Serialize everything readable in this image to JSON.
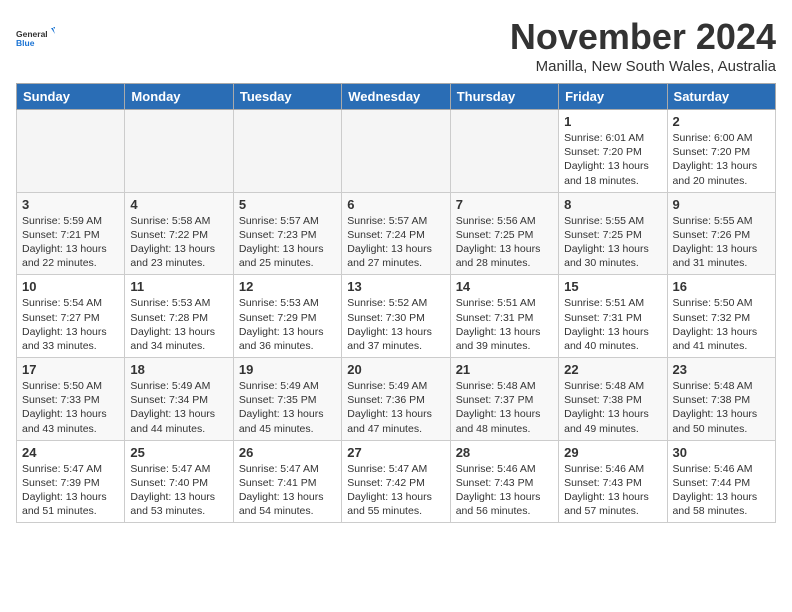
{
  "logo": {
    "line1": "General",
    "line2": "Blue"
  },
  "title": "November 2024",
  "location": "Manilla, New South Wales, Australia",
  "days_of_week": [
    "Sunday",
    "Monday",
    "Tuesday",
    "Wednesday",
    "Thursday",
    "Friday",
    "Saturday"
  ],
  "weeks": [
    [
      {
        "day": "",
        "info": "",
        "empty": true
      },
      {
        "day": "",
        "info": "",
        "empty": true
      },
      {
        "day": "",
        "info": "",
        "empty": true
      },
      {
        "day": "",
        "info": "",
        "empty": true
      },
      {
        "day": "",
        "info": "",
        "empty": true
      },
      {
        "day": "1",
        "info": "Sunrise: 6:01 AM\nSunset: 7:20 PM\nDaylight: 13 hours\nand 18 minutes.",
        "empty": false
      },
      {
        "day": "2",
        "info": "Sunrise: 6:00 AM\nSunset: 7:20 PM\nDaylight: 13 hours\nand 20 minutes.",
        "empty": false
      }
    ],
    [
      {
        "day": "3",
        "info": "Sunrise: 5:59 AM\nSunset: 7:21 PM\nDaylight: 13 hours\nand 22 minutes.",
        "empty": false
      },
      {
        "day": "4",
        "info": "Sunrise: 5:58 AM\nSunset: 7:22 PM\nDaylight: 13 hours\nand 23 minutes.",
        "empty": false
      },
      {
        "day": "5",
        "info": "Sunrise: 5:57 AM\nSunset: 7:23 PM\nDaylight: 13 hours\nand 25 minutes.",
        "empty": false
      },
      {
        "day": "6",
        "info": "Sunrise: 5:57 AM\nSunset: 7:24 PM\nDaylight: 13 hours\nand 27 minutes.",
        "empty": false
      },
      {
        "day": "7",
        "info": "Sunrise: 5:56 AM\nSunset: 7:25 PM\nDaylight: 13 hours\nand 28 minutes.",
        "empty": false
      },
      {
        "day": "8",
        "info": "Sunrise: 5:55 AM\nSunset: 7:25 PM\nDaylight: 13 hours\nand 30 minutes.",
        "empty": false
      },
      {
        "day": "9",
        "info": "Sunrise: 5:55 AM\nSunset: 7:26 PM\nDaylight: 13 hours\nand 31 minutes.",
        "empty": false
      }
    ],
    [
      {
        "day": "10",
        "info": "Sunrise: 5:54 AM\nSunset: 7:27 PM\nDaylight: 13 hours\nand 33 minutes.",
        "empty": false
      },
      {
        "day": "11",
        "info": "Sunrise: 5:53 AM\nSunset: 7:28 PM\nDaylight: 13 hours\nand 34 minutes.",
        "empty": false
      },
      {
        "day": "12",
        "info": "Sunrise: 5:53 AM\nSunset: 7:29 PM\nDaylight: 13 hours\nand 36 minutes.",
        "empty": false
      },
      {
        "day": "13",
        "info": "Sunrise: 5:52 AM\nSunset: 7:30 PM\nDaylight: 13 hours\nand 37 minutes.",
        "empty": false
      },
      {
        "day": "14",
        "info": "Sunrise: 5:51 AM\nSunset: 7:31 PM\nDaylight: 13 hours\nand 39 minutes.",
        "empty": false
      },
      {
        "day": "15",
        "info": "Sunrise: 5:51 AM\nSunset: 7:31 PM\nDaylight: 13 hours\nand 40 minutes.",
        "empty": false
      },
      {
        "day": "16",
        "info": "Sunrise: 5:50 AM\nSunset: 7:32 PM\nDaylight: 13 hours\nand 41 minutes.",
        "empty": false
      }
    ],
    [
      {
        "day": "17",
        "info": "Sunrise: 5:50 AM\nSunset: 7:33 PM\nDaylight: 13 hours\nand 43 minutes.",
        "empty": false
      },
      {
        "day": "18",
        "info": "Sunrise: 5:49 AM\nSunset: 7:34 PM\nDaylight: 13 hours\nand 44 minutes.",
        "empty": false
      },
      {
        "day": "19",
        "info": "Sunrise: 5:49 AM\nSunset: 7:35 PM\nDaylight: 13 hours\nand 45 minutes.",
        "empty": false
      },
      {
        "day": "20",
        "info": "Sunrise: 5:49 AM\nSunset: 7:36 PM\nDaylight: 13 hours\nand 47 minutes.",
        "empty": false
      },
      {
        "day": "21",
        "info": "Sunrise: 5:48 AM\nSunset: 7:37 PM\nDaylight: 13 hours\nand 48 minutes.",
        "empty": false
      },
      {
        "day": "22",
        "info": "Sunrise: 5:48 AM\nSunset: 7:38 PM\nDaylight: 13 hours\nand 49 minutes.",
        "empty": false
      },
      {
        "day": "23",
        "info": "Sunrise: 5:48 AM\nSunset: 7:38 PM\nDaylight: 13 hours\nand 50 minutes.",
        "empty": false
      }
    ],
    [
      {
        "day": "24",
        "info": "Sunrise: 5:47 AM\nSunset: 7:39 PM\nDaylight: 13 hours\nand 51 minutes.",
        "empty": false
      },
      {
        "day": "25",
        "info": "Sunrise: 5:47 AM\nSunset: 7:40 PM\nDaylight: 13 hours\nand 53 minutes.",
        "empty": false
      },
      {
        "day": "26",
        "info": "Sunrise: 5:47 AM\nSunset: 7:41 PM\nDaylight: 13 hours\nand 54 minutes.",
        "empty": false
      },
      {
        "day": "27",
        "info": "Sunrise: 5:47 AM\nSunset: 7:42 PM\nDaylight: 13 hours\nand 55 minutes.",
        "empty": false
      },
      {
        "day": "28",
        "info": "Sunrise: 5:46 AM\nSunset: 7:43 PM\nDaylight: 13 hours\nand 56 minutes.",
        "empty": false
      },
      {
        "day": "29",
        "info": "Sunrise: 5:46 AM\nSunset: 7:43 PM\nDaylight: 13 hours\nand 57 minutes.",
        "empty": false
      },
      {
        "day": "30",
        "info": "Sunrise: 5:46 AM\nSunset: 7:44 PM\nDaylight: 13 hours\nand 58 minutes.",
        "empty": false
      }
    ]
  ]
}
